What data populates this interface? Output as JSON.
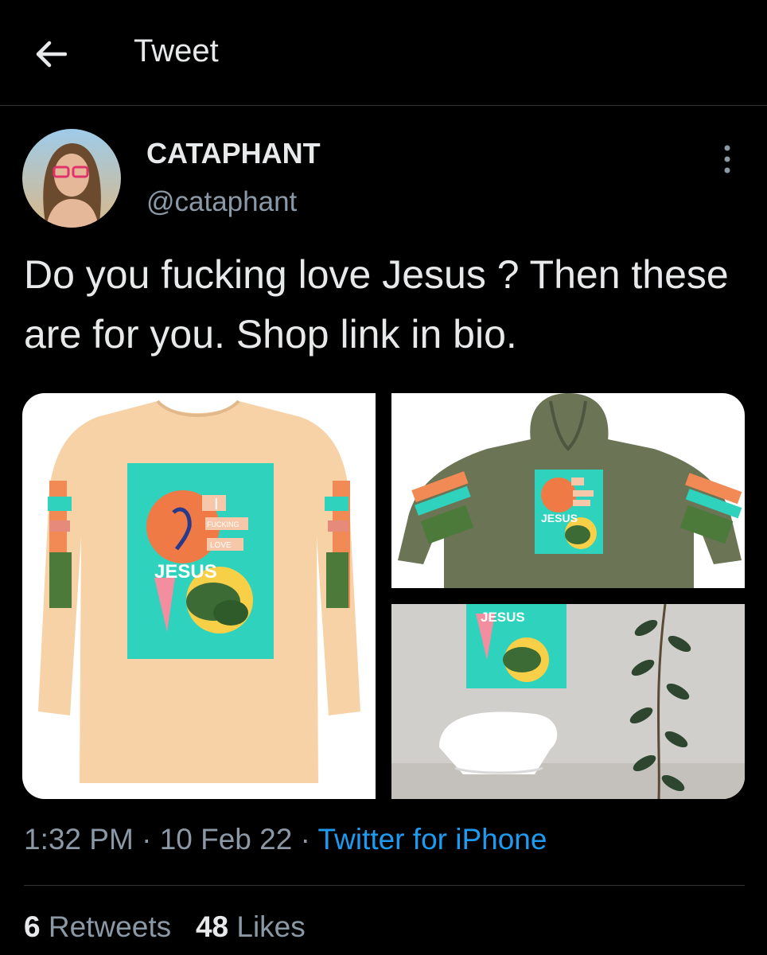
{
  "header": {
    "title": "Tweet"
  },
  "tweet": {
    "display_name": "CATAPHANT",
    "handle": "@cataphant",
    "text": "Do you fucking love Jesus ? Then these are for you. Shop link in bio.",
    "time": "1:32 PM",
    "date": "10 Feb 22",
    "source": "Twitter for iPhone",
    "separator": " · "
  },
  "media": {
    "print_lines": [
      "I",
      "FUCKING",
      "LOVE",
      "JESUS"
    ]
  },
  "stats": {
    "retweets_count": "6",
    "retweets_label": "Retweets",
    "likes_count": "48",
    "likes_label": "Likes"
  },
  "colors": {
    "background": "#000000",
    "text": "#e7e9ea",
    "secondary": "#8b98a5",
    "link": "#1d9bf0",
    "print_teal": "#2fd3bd",
    "shirt": "#f6d2a6",
    "hoodie": "#6b7454"
  }
}
